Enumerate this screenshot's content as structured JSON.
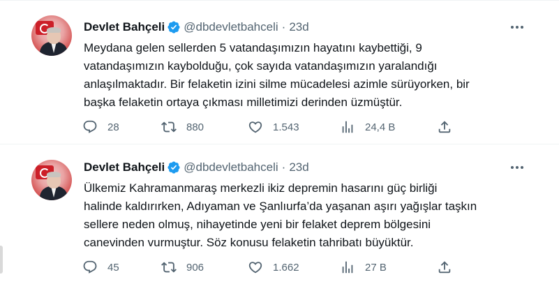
{
  "colors": {
    "text": "#0f1419",
    "secondary": "#536471",
    "verified": "#1d9bf0",
    "divider": "#eff3f4"
  },
  "icons": [
    "verified-badge-icon",
    "more-icon",
    "reply-icon",
    "retweet-icon",
    "like-icon",
    "views-icon",
    "share-icon"
  ],
  "tweets": [
    {
      "author_name": "Devlet Bahçeli",
      "handle": "@dbdevletbahceli",
      "separator": "·",
      "time": "23d",
      "text": "Meydana gelen sellerden 5 vatandaşımızın hayatını kaybettiği, 9\nvatandaşımızın kaybolduğu, çok sayıda vatandaşımızın yaralandığı\nanlaşılmaktadır. Bir felaketin izini silme mücadelesi azimle sürüyorken, bir\nbaşka felaketin ortaya çıkması milletimizi derinden üzmüştür.",
      "replies": "28",
      "retweets": "880",
      "likes": "1.543",
      "views": "24,4 B"
    },
    {
      "author_name": "Devlet Bahçeli",
      "handle": "@dbdevletbahceli",
      "separator": "·",
      "time": "23d",
      "text": "Ülkemiz Kahramanmaraş merkezli ikiz depremin hasarını güç birliği\nhalinde kaldırırken, Adıyaman ve Şanlıurfa’da yaşanan aşırı yağışlar taşkın\nsellere neden olmuş, nihayetinde yeni bir felaket deprem bölgesini\ncanevinden vurmuştur. Söz konusu felaketin tahribatı büyüktür.",
      "replies": "45",
      "retweets": "906",
      "likes": "1.662",
      "views": "27 B"
    }
  ]
}
